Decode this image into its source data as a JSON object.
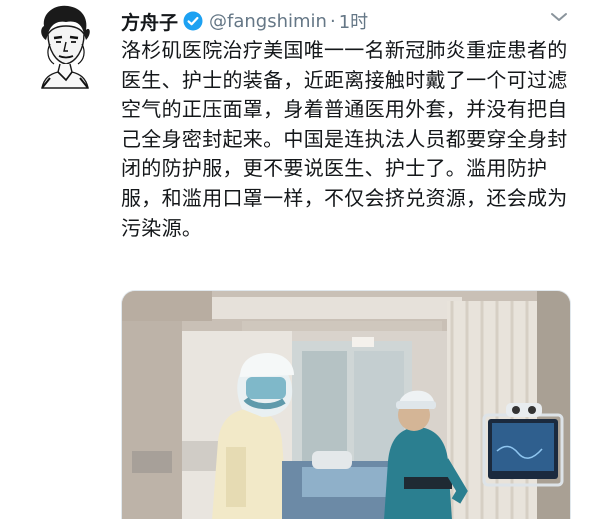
{
  "tweet": {
    "author_name": "方舟子",
    "handle": "@fangshimin",
    "separator": "·",
    "time": "1时",
    "text": "洛杉矶医院治疗美国唯一一名新冠肺炎重症患者的医生、护士的装备，近距离接触时戴了一个可过滤空气的正压面罩，身着普通医用外套，并没有把自己全身密封起来。中国是连执法人员都要穿全身封闭的防护服，更不要说医生、护士了。滥用防护服，和滥用口罩一样，不仅会挤兑资源，还会成为污染源。"
  },
  "icons": {
    "verified": "verified-badge-icon",
    "menu": "chevron-down-icon"
  },
  "colors": {
    "verified_blue": "#1da1f2",
    "secondary_text": "#657786",
    "primary_text": "#14171a",
    "scrub_teal": "#2b7f90"
  }
}
